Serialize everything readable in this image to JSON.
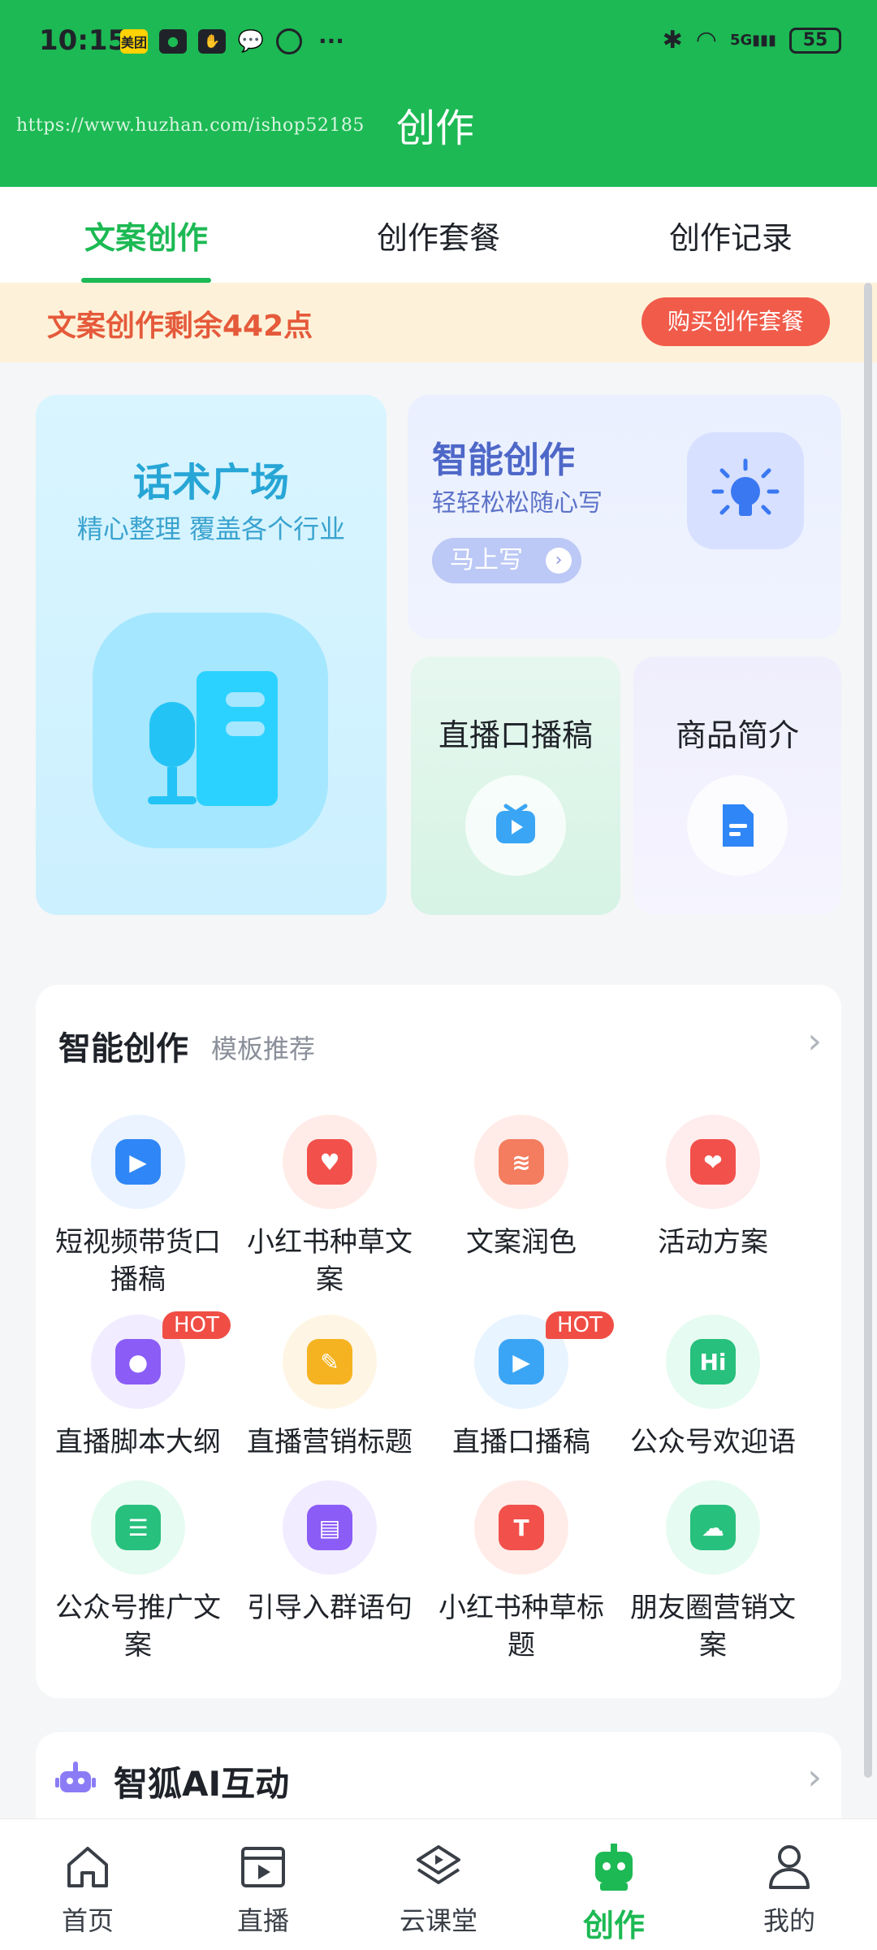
{
  "status": {
    "time": "10:15",
    "chip1": "美团",
    "battery": "55",
    "net": "5G"
  },
  "header": {
    "url_text": "https://www.huzhan.com/ishop52185",
    "title": "创作"
  },
  "tabs": [
    {
      "label": "文案创作",
      "active": true
    },
    {
      "label": "创作套餐",
      "active": false
    },
    {
      "label": "创作记录",
      "active": false
    }
  ],
  "points": {
    "text": "文案创作剩余442点",
    "buy_label": "购买创作套餐"
  },
  "features": {
    "big": {
      "title": "话术广场",
      "subtitle": "精心整理 覆盖各个行业"
    },
    "smart": {
      "title": "智能创作",
      "subtitle": "轻轻松松随心写",
      "button": "马上写"
    },
    "live": {
      "title": "直播口播稿"
    },
    "goods": {
      "title": "商品简介"
    }
  },
  "section": {
    "title": "智能创作",
    "subtitle": "模板推荐",
    "items": [
      {
        "label": "短视频带货口播稿",
        "hot": false,
        "bg": "#eaf3ff",
        "fg": "#2f86f6"
      },
      {
        "label": "小红书种草文案",
        "hot": false,
        "bg": "#ffece8",
        "fg": "#f2504b"
      },
      {
        "label": "文案润色",
        "hot": false,
        "bg": "#ffece8",
        "fg": "#f47c5f"
      },
      {
        "label": "活动方案",
        "hot": false,
        "bg": "#ffecec",
        "fg": "#f2504b"
      },
      {
        "label": "直播脚本大纲",
        "hot": true,
        "hot_text": "HOT",
        "bg": "#f1ecff",
        "fg": "#8b5cf6"
      },
      {
        "label": "直播营销标题",
        "hot": false,
        "bg": "#fff5e4",
        "fg": "#f5b321"
      },
      {
        "label": "直播口播稿",
        "hot": true,
        "hot_text": "HOT",
        "bg": "#e8f4ff",
        "fg": "#3ba5f5"
      },
      {
        "label": "公众号欢迎语",
        "hot": false,
        "bg": "#e6fbf1",
        "fg": "#27c07d"
      },
      {
        "label": "公众号推广文案",
        "hot": false,
        "bg": "#e6fbf1",
        "fg": "#27c07d"
      },
      {
        "label": "引导入群语句",
        "hot": false,
        "bg": "#f1ecff",
        "fg": "#8b5cf6"
      },
      {
        "label": "小红书种草标题",
        "hot": false,
        "bg": "#ffece8",
        "fg": "#f2504b"
      },
      {
        "label": "朋友圈营销文案",
        "hot": false,
        "bg": "#e6fbf1",
        "fg": "#27c07d"
      }
    ]
  },
  "ai": {
    "label": "智狐AI互动"
  },
  "nav": [
    {
      "label": "首页",
      "icon": "home-icon",
      "active": false
    },
    {
      "label": "直播",
      "icon": "video-icon",
      "active": false
    },
    {
      "label": "云课堂",
      "icon": "course-icon",
      "active": false
    },
    {
      "label": "创作",
      "icon": "robot-icon",
      "active": true
    },
    {
      "label": "我的",
      "icon": "user-icon",
      "active": false
    }
  ]
}
